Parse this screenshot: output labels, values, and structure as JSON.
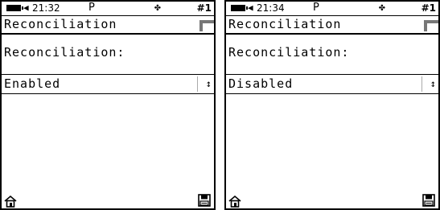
{
  "screens": [
    {
      "status": {
        "time": "21:32",
        "mode": "P",
        "move_glyph": "✤",
        "number": "#1"
      },
      "title": "Reconciliation",
      "label": "Reconciliation:",
      "value": "Enabled",
      "spin_glyph": "↕"
    },
    {
      "status": {
        "time": "21:34",
        "mode": "P",
        "move_glyph": "✤",
        "number": "#1"
      },
      "title": "Reconciliation",
      "label": "Reconciliation:",
      "value": "Disabled",
      "spin_glyph": "↕"
    }
  ],
  "icons": {
    "battery": "battery-icon",
    "plug": "plug-icon",
    "move": "move-icon",
    "corner": "menu-corner-icon",
    "spinner": "spinner-arrows-icon",
    "home": "home-icon",
    "save": "save-icon"
  }
}
